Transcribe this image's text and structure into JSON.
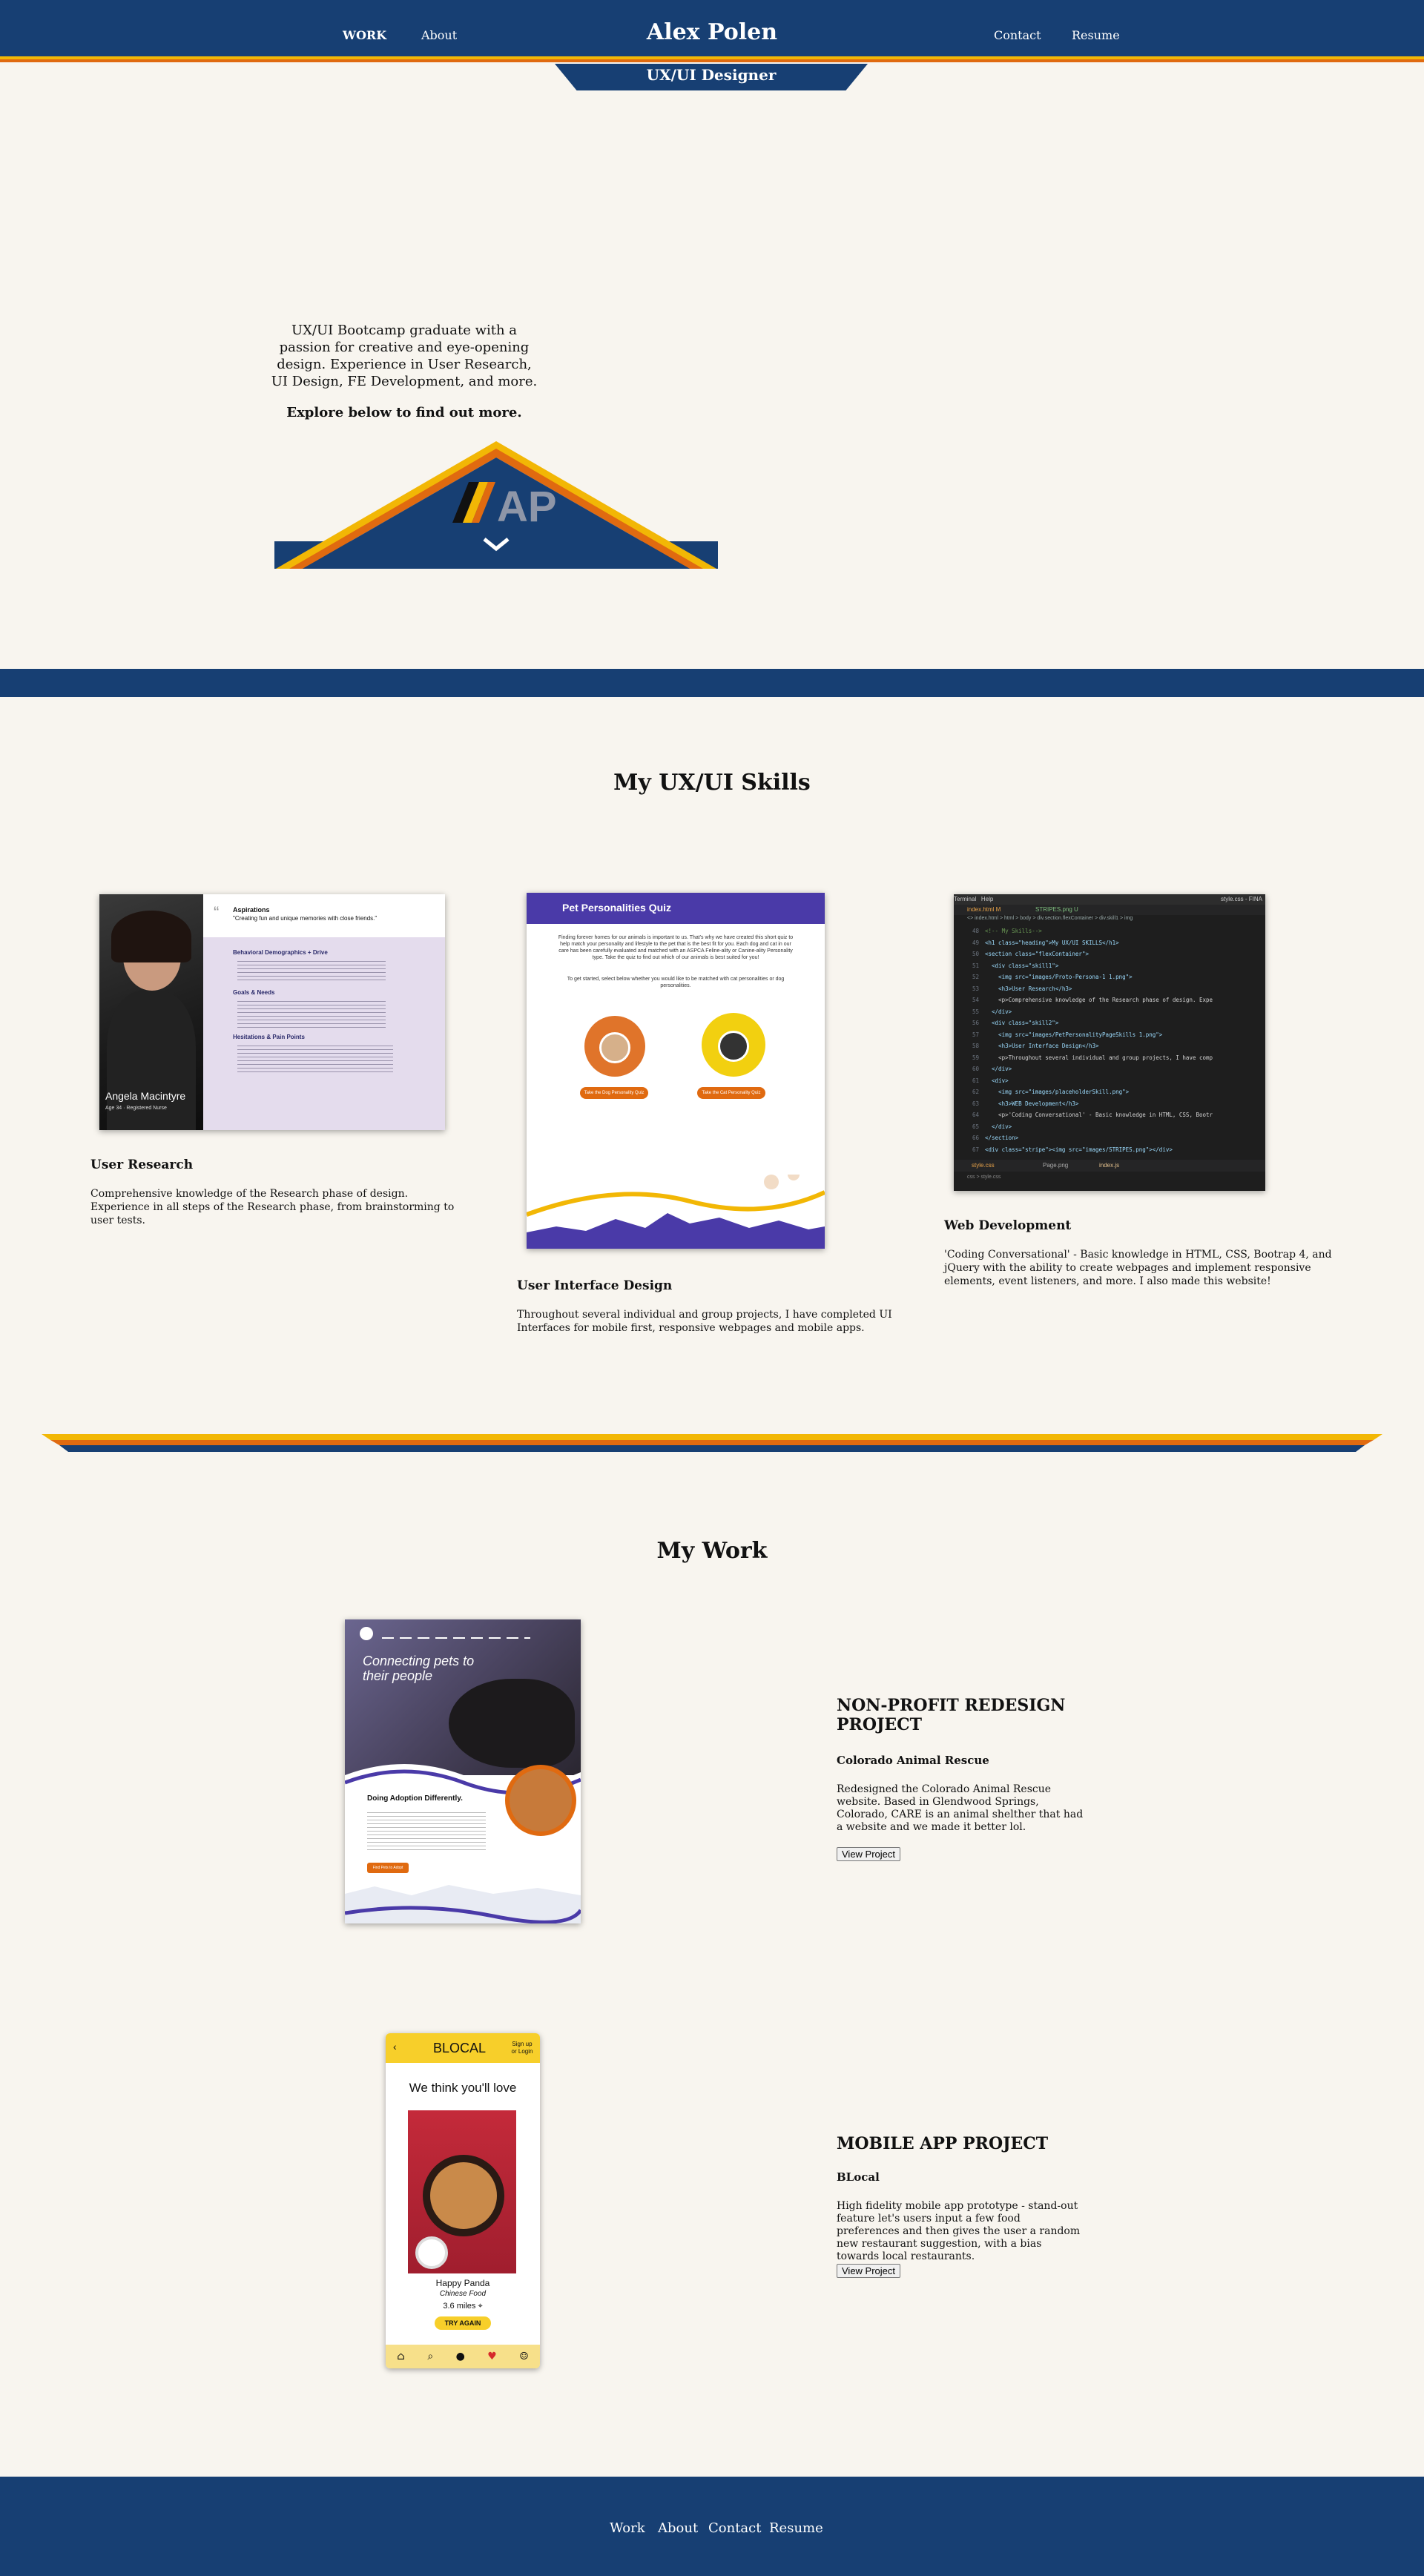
{
  "nav": {
    "work": "WORK",
    "about": "About",
    "brand": "Alex Polen",
    "contact": "Contact",
    "resume": "Resume",
    "subtitle": "UX/UI Designer"
  },
  "hero": {
    "intro": "UX/UI Bootcamp graduate with a passion for creative and eye-opening design. Experience in User Research, UI Design, FE Development, and more.",
    "cta": "Explore below to find out more.",
    "logo_letters": "AP"
  },
  "skills": {
    "title": "My UX/UI Skills",
    "items": [
      {
        "title": "User Research",
        "text": "Comprehensive knowledge of the Research phase of design. Experience in all steps of the Research phase, from brainstorming to user tests.",
        "persona": {
          "heading": "Aspirations",
          "quote": "\"Creating fun and unique memories with close friends.\"",
          "s1": "Behavioral Demographics + Drive",
          "s2": "Goals & Needs",
          "s3": "Hesitations & Pain Points",
          "name": "Angela Macintyre",
          "meta": "Age 34 · Registered Nurse"
        }
      },
      {
        "title": "User Interface Design",
        "text": "Throughout several individual and group projects, I have completed UI Interfaces for mobile first, responsive webpages and mobile apps.",
        "quiz": {
          "heading": "Pet Personalities Quiz",
          "intro": "Finding forever homes for our animals is important to us. That's why we have created this short quiz to help match your personality and lifestyle to the pet that is the best fit for you. Each dog and cat in our care has been carefully evaluated and matched with an ASPCA Feline-ality or Canine-ality Personality type. Take the quiz to find out which of our animals is best suited for you!",
          "intro2": "To get started, select below whether you would like to be matched with cat personalities or dog personalities.",
          "btn1": "Take the Dog Personality Quiz",
          "btn2": "Take the Cat Personality Quiz"
        }
      },
      {
        "title": "Web Development",
        "text": "'Coding Conversational' - Basic knowledge in HTML, CSS, Bootrap 4, and jQuery with the ability to create webpages and implement responsive elements, event listeners, and more. I also made this website!",
        "code": {
          "menu1": "Terminal",
          "menu2": "Help",
          "title": "style.css - FINA",
          "tab1": "index.html M",
          "tab2": "STRIPES.png U",
          "crumbs": "<> index.html > html > body > div.section.flexContainer > div.skill1 > img",
          "lines": [
            "<!-- My Skills-->",
            "<h1 class=\"heading\">My UX/UI SKILLS</h1>",
            "<section class=\"flexContainer\">",
            "  <div class=\"skill1\">",
            "    <img src=\"images/Proto-Persona-1 1.png\">",
            "    <h3>User Research</h3>",
            "    <p>Comprehensive knowledge of the Research phase of design. Expe",
            "  </div>",
            "  <div class=\"skill2\">",
            "    <img src=\"images/PetPersonalityPageSkills 1.png\">",
            "    <h3>User Interface Design</h3>",
            "    <p>Throughout several individual and group projects, I have comp",
            "  </div>",
            "  <div>",
            "    <img src=\"images/placeholderSkill.png\">",
            "    <h3>WEB Development</h3>",
            "    <p>'Coding Conversational' - Basic knowledge in HTML, CSS, Bootr",
            "  </div>",
            "</section>",
            "<div class=\"stripe\"><img src=\"images/STRIPES.png\"></div>"
          ],
          "line_start": 48,
          "bottom_tab1": "style.css",
          "bottom_tab2": "Page.png",
          "bottom_tab3": "index.js",
          "footer_tab1": "css",
          "footer_tab2": "style.css"
        }
      }
    ]
  },
  "work": {
    "title": "My Work",
    "projects": [
      {
        "title": "NON-PROFIT REDESIGN PROJECT",
        "client": "Colorado Animal Rescue",
        "text": "Redesigned the Colorado Animal Rescue website. Based in Glendwood Springs, Colorado, CARE is an animal shelther that had a website and we made it better lol.",
        "button": "View Project",
        "mock": {
          "hero": "Connecting pets to their people",
          "heading": "Doing Adoption Differently.",
          "btn": "Find Pets to Adopt"
        }
      },
      {
        "title": "MOBILE APP PROJECT",
        "client": "BLocal",
        "text": "High fidelity mobile app prototype - stand-out feature let's users input a few food preferences and then gives the user a random new restaurant suggestion, with a bias towards local restaurants.",
        "button": "View Project",
        "app": {
          "brand": "BLOCAL",
          "signup": "Sign up or Login",
          "heading": "We think you'll love",
          "restaurant": "Happy Panda",
          "cuisine": "Chinese Food",
          "distance": "3.6 miles",
          "btn": "TRY AGAIN"
        }
      }
    ]
  },
  "footer": {
    "work": "Work",
    "about": "About",
    "contact": "Contact",
    "resume": "Resume"
  },
  "colors": {
    "navy": "#173f73",
    "gold": "#f2b705",
    "orange": "#e06a10",
    "cream": "#f8f5ef"
  }
}
